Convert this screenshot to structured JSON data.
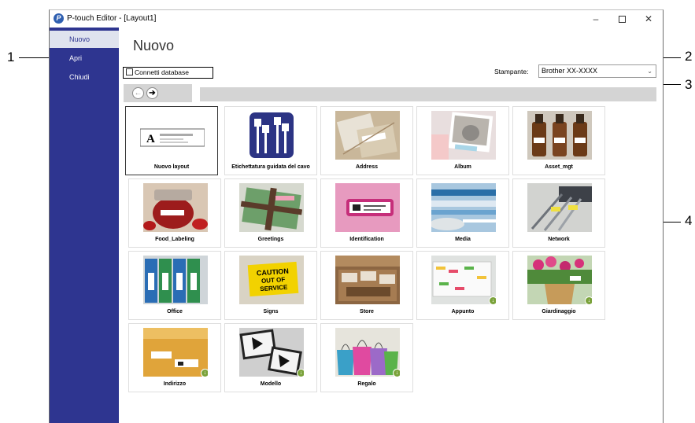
{
  "window": {
    "title": "P-touch Editor - [Layout1]",
    "app_icon_glyph": "P",
    "controls": {
      "minimize": "–",
      "close": "✕"
    }
  },
  "sidebar": {
    "items": [
      {
        "label": "Nuovo",
        "active": true
      },
      {
        "label": "Apri",
        "active": false
      },
      {
        "label": "Chiudi",
        "active": false
      }
    ]
  },
  "main": {
    "title": "Nuovo",
    "connect_db": {
      "label": "Connetti database",
      "checked": false
    },
    "printer": {
      "label": "Stampante:",
      "value": "Brother XX-XXXX"
    },
    "nav": {
      "back": "←",
      "forward": "➔"
    }
  },
  "templates": [
    {
      "label": "Nuovo layout",
      "icon": "blank-layout-icon",
      "selected": true,
      "download": false
    },
    {
      "label": "Etichettatura guidata del cavo",
      "icon": "cable-label-icon",
      "selected": false,
      "download": false
    },
    {
      "label": "Address",
      "icon": "address-image",
      "selected": false,
      "download": false
    },
    {
      "label": "Album",
      "icon": "album-image",
      "selected": false,
      "download": false
    },
    {
      "label": "Asset_mgt",
      "icon": "asset-image",
      "selected": false,
      "download": false
    },
    {
      "label": "Food_Labeling",
      "icon": "food-image",
      "selected": false,
      "download": false
    },
    {
      "label": "Greetings",
      "icon": "greetings-image",
      "selected": false,
      "download": false
    },
    {
      "label": "Identification",
      "icon": "identification-image",
      "selected": false,
      "download": false
    },
    {
      "label": "Media",
      "icon": "media-image",
      "selected": false,
      "download": false
    },
    {
      "label": "Network",
      "icon": "network-image",
      "selected": false,
      "download": false
    },
    {
      "label": "Office",
      "icon": "office-image",
      "selected": false,
      "download": false
    },
    {
      "label": "Signs",
      "icon": "signs-image",
      "selected": false,
      "download": false,
      "sign_text": [
        "CAUTION",
        "OUT OF",
        "SERVICE"
      ]
    },
    {
      "label": "Store",
      "icon": "store-image",
      "selected": false,
      "download": false
    },
    {
      "label": "Appunto",
      "icon": "memo-image",
      "selected": false,
      "download": true
    },
    {
      "label": "Giardinaggio",
      "icon": "gardening-image",
      "selected": false,
      "download": true
    },
    {
      "label": "Indirizzo",
      "icon": "envelope-image",
      "selected": false,
      "download": true
    },
    {
      "label": "Modello",
      "icon": "model-image",
      "selected": false,
      "download": true
    },
    {
      "label": "Regalo",
      "icon": "gift-image",
      "selected": false,
      "download": true
    }
  ],
  "callouts": [
    "1",
    "2",
    "3",
    "4"
  ]
}
